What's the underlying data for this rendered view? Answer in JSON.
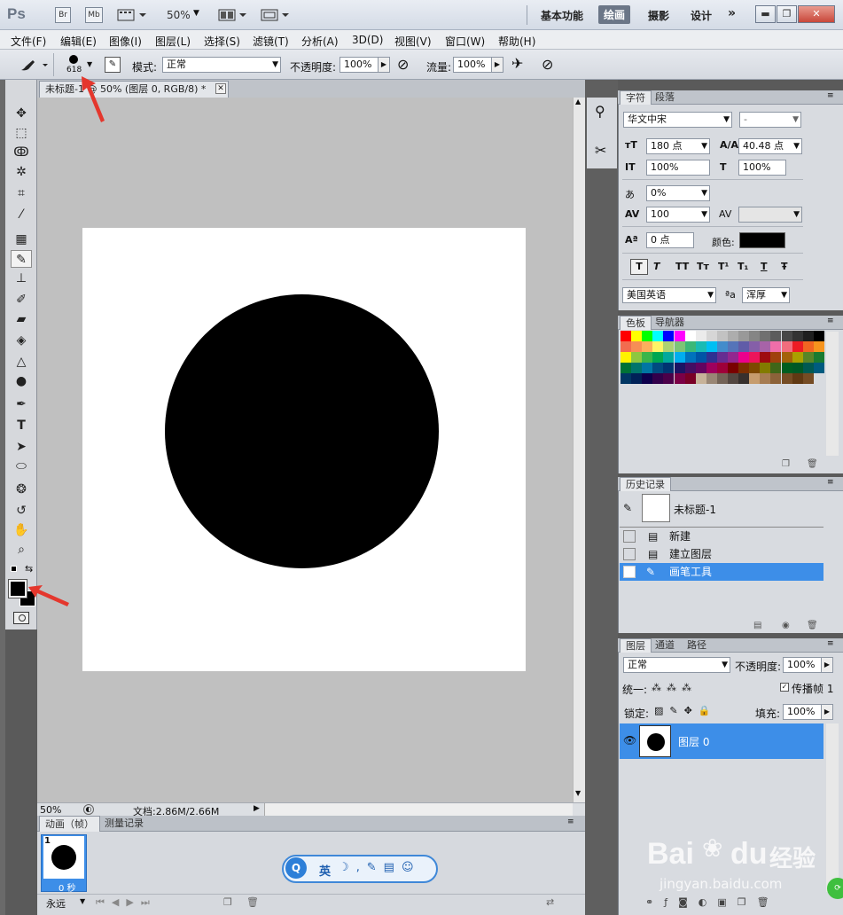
{
  "app": {
    "logo": "Ps",
    "zoom": "50%",
    "launch_bridge": "Br",
    "launch_mini": "Mb"
  },
  "workspaces": [
    "基本功能",
    "绘画",
    "摄影",
    "设计"
  ],
  "workspace_active": "绘画",
  "workspace_more": "»",
  "menu": [
    "文件(F)",
    "编辑(E)",
    "图像(I)",
    "图层(L)",
    "选择(S)",
    "滤镜(T)",
    "分析(A)",
    "3D(D)",
    "视图(V)",
    "窗口(W)",
    "帮助(H)"
  ],
  "options": {
    "brush_size": "618",
    "mode_label": "模式:",
    "mode_value": "正常",
    "opacity_label": "不透明度:",
    "opacity_value": "100%",
    "flow_label": "流量:",
    "flow_value": "100%"
  },
  "document": {
    "tab_title": "未标题-1 @ 50% (图层 0, RGB/8) *",
    "status_zoom": "50%",
    "status_doc": "文档:2.86M/2.66M"
  },
  "animation": {
    "tabs": [
      "动画（帧）",
      "测量记录"
    ],
    "frame_number": "1",
    "frame_delay": "0 秒",
    "loop": "永远"
  },
  "ime": {
    "lang": "英"
  },
  "character": {
    "tabs": [
      "字符",
      "段落"
    ],
    "font": "华文中宋",
    "style": "-",
    "size": "180 点",
    "leading": "40.48 点",
    "vscale": "100%",
    "hscale": "100%",
    "tracking_pct": "0%",
    "tracking": "100",
    "baseline": "0 点",
    "color_label": "颜色:",
    "language": "美国英语",
    "aa_label": "ªa",
    "antialias": "浑厚",
    "style_buttons": [
      "T",
      "T",
      "TT",
      "Tт",
      "T¹",
      "T₁",
      "T",
      "Ŧ"
    ]
  },
  "swatches": {
    "tabs": [
      "色板",
      "导航器"
    ],
    "colors": [
      "#ff0000",
      "#ffff00",
      "#00ff00",
      "#00ffff",
      "#0000ff",
      "#ff00ff",
      "#ffffff",
      "#ebebeb",
      "#d6d6d6",
      "#c2c2c2",
      "#adadad",
      "#999999",
      "#858585",
      "#707070",
      "#5c5c5c",
      "#474747",
      "#333333",
      "#1f1f1f",
      "#000000",
      "#f26c4f",
      "#f68e55",
      "#fbaf5c",
      "#fff467",
      "#acd372",
      "#7cc576",
      "#3bb878",
      "#1abbb4",
      "#00bff3",
      "#438ccb",
      "#5574b9",
      "#605ca8",
      "#855fa8",
      "#a763a8",
      "#f06ea9",
      "#f26d7d",
      "#ed1c24",
      "#f26522",
      "#f7941d",
      "#fff200",
      "#8dc73f",
      "#39b54a",
      "#00a651",
      "#00a99d",
      "#00aeef",
      "#0072bc",
      "#0054a6",
      "#2e3192",
      "#662d91",
      "#92278f",
      "#ec008c",
      "#ed145b",
      "#9e0b0f",
      "#a0410d",
      "#a36209",
      "#aba000",
      "#598527",
      "#1a7b30",
      "#007236",
      "#00746b",
      "#0076a3",
      "#004b80",
      "#003471",
      "#1b1464",
      "#440e62",
      "#630460",
      "#9e005d",
      "#9e0039",
      "#790000",
      "#7b2e00",
      "#7d4900",
      "#827b00",
      "#406618",
      "#005e20",
      "#005826",
      "#005952",
      "#005b7f",
      "#003663",
      "#002157",
      "#0d004c",
      "#32004b",
      "#4b0049",
      "#7b0046",
      "#7a0026",
      "#c7b299",
      "#998675",
      "#736357",
      "#534741",
      "#37302d",
      "#c69c6d",
      "#a67c52",
      "#8c6239",
      "#754c24",
      "#603913",
      "#754c24"
    ]
  },
  "history": {
    "tabs": [
      "历史记录"
    ],
    "snapshot": "未标题-1",
    "items": [
      "新建",
      "建立图层",
      "画笔工具"
    ]
  },
  "layers": {
    "tabs": [
      "图层",
      "通道",
      "路径"
    ],
    "blend": "正常",
    "opacity_label": "不透明度:",
    "opacity": "100%",
    "unify_label": "统一:",
    "propagate": "传播帧 1",
    "lock_label": "锁定:",
    "fill_label": "填充:",
    "fill": "100%",
    "layer_name": "图层 0"
  },
  "watermark": {
    "brand": "Bai",
    "brand2": "du",
    "cn": "经验",
    "url": "jingyan.baidu.com"
  }
}
